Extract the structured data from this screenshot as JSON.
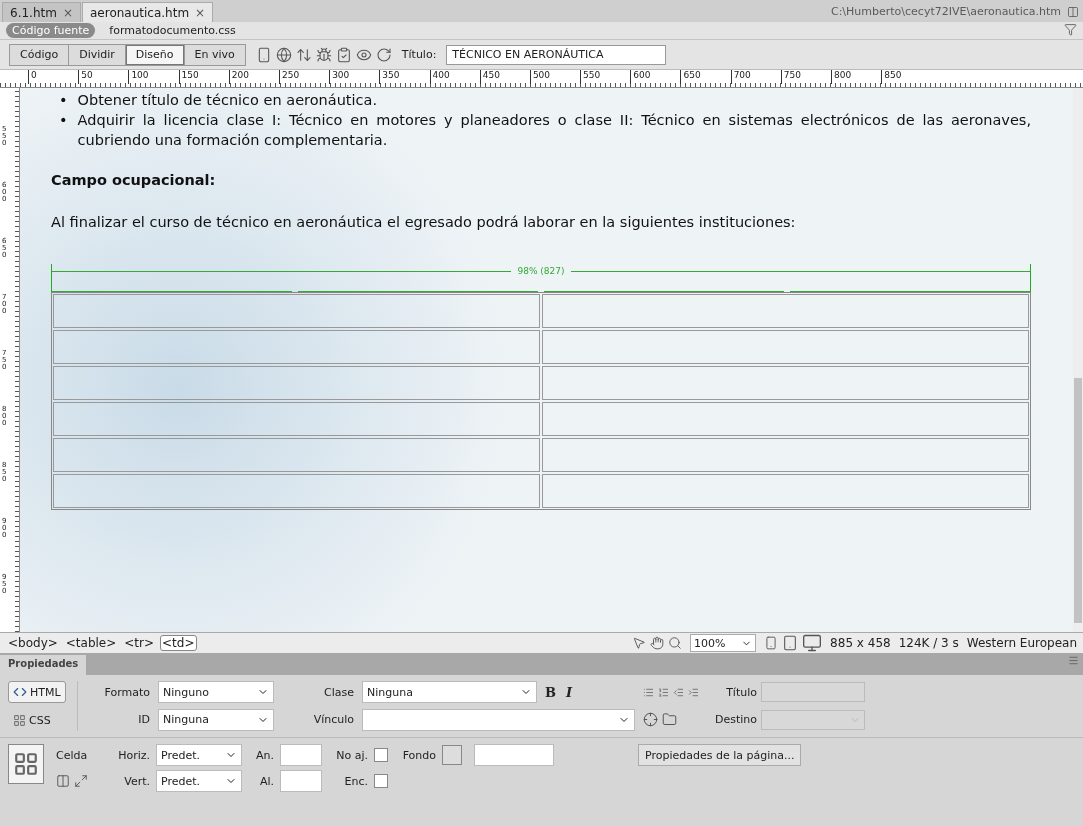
{
  "tabs": [
    {
      "label": "6.1.htm",
      "close": "×",
      "selected": false
    },
    {
      "label": "aeronautica.htm",
      "close": "×",
      "selected": true
    }
  ],
  "file_path": "C:\\Humberto\\cecyt72IVE\\aeronautica.htm",
  "related_files": [
    {
      "label": "Código fuente",
      "selected": true
    },
    {
      "label": "formatodocumento.css",
      "selected": false
    }
  ],
  "view_buttons": [
    {
      "label": "Código",
      "selected": false
    },
    {
      "label": "Dividir",
      "selected": false
    },
    {
      "label": "Diseño",
      "selected": true
    },
    {
      "label": "En vivo",
      "selected": false
    }
  ],
  "title_field": {
    "label": "Título:",
    "value": "TÉCNICO EN AERONÁUTICA"
  },
  "ruler": {
    "horizontal": [
      "0",
      "50",
      "100",
      "150",
      "200",
      "250",
      "300",
      "350",
      "400",
      "450",
      "500",
      "550",
      "600",
      "650",
      "700",
      "750",
      "800",
      "850"
    ],
    "vertical": [
      "550",
      "600",
      "650",
      "700",
      "750",
      "800",
      "850",
      "900",
      "950"
    ]
  },
  "document": {
    "bullets": [
      {
        "marker": "•",
        "text": "Obtener título de técnico en aeronáutica."
      },
      {
        "marker": "•",
        "text": "Adquirir la licencia clase I: Técnico en motores y planeadores o clase II: Técnico en sistemas electrónicos de las aeronaves, cubriendo una formación complementaria."
      }
    ],
    "heading": "Campo ocupacional:",
    "paragraph": "Al finalizar el curso de técnico en aeronáutica el egresado podrá laborar en la siguientes instituciones:",
    "table": {
      "width_label": "98% (827)",
      "columns": [
        {
          "kind": "empty"
        },
        {
          "kind": "empty"
        }
      ],
      "rows": [
        {
          "kind": "empty"
        },
        {
          "kind": "empty"
        },
        {
          "kind": "empty"
        },
        {
          "kind": "empty"
        },
        {
          "kind": "empty"
        },
        {
          "kind": "empty"
        }
      ]
    }
  },
  "tag_selector": [
    {
      "label": "<body>",
      "selected": false
    },
    {
      "label": "<table>",
      "selected": false
    },
    {
      "label": "<tr>",
      "selected": false
    },
    {
      "label": "<td>",
      "selected": true
    }
  ],
  "status": {
    "zoom": "100%",
    "size": "885 x 458",
    "download": "124K / 3 s",
    "encoding": "Western European"
  },
  "properties": {
    "title": "Propiedades",
    "modes": [
      {
        "label": "HTML",
        "selected": true
      },
      {
        "label": "CSS",
        "selected": false
      }
    ],
    "formato": {
      "label": "Formato",
      "value": "Ninguno"
    },
    "id": {
      "label": "ID",
      "value": "Ninguna"
    },
    "clase": {
      "label": "Clase",
      "value": "Ninguna"
    },
    "vinculo": {
      "label": "Vínculo"
    },
    "bold": "B",
    "italic": "I",
    "titulo": {
      "label": "Título",
      "disabled": true
    },
    "destino": {
      "label": "Destino",
      "disabled": true
    },
    "cell_label": "Celda",
    "horiz": {
      "label": "Horiz.",
      "value": "Predet."
    },
    "vert": {
      "label": "Vert.",
      "value": "Predet."
    },
    "an": {
      "label": "An."
    },
    "al": {
      "label": "Al."
    },
    "no_aj": {
      "label": "No aj.",
      "checked": false
    },
    "enc": {
      "label": "Enc.",
      "checked": false
    },
    "fondo": {
      "label": "Fondo"
    },
    "page_button": "Propiedades de la página..."
  }
}
